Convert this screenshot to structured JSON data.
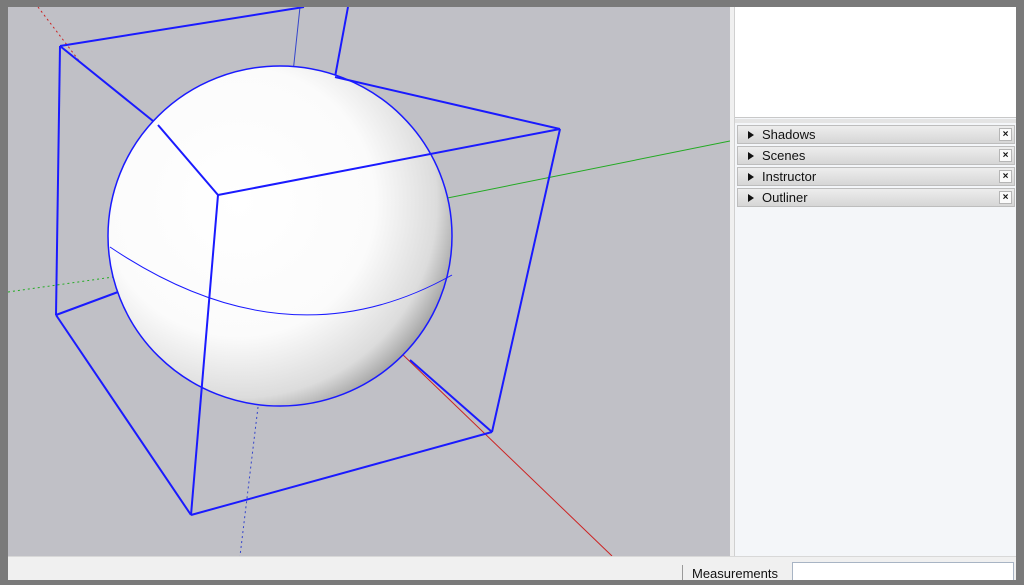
{
  "tray": {
    "panels": [
      {
        "label": "Shadows"
      },
      {
        "label": "Scenes"
      },
      {
        "label": "Instructor"
      },
      {
        "label": "Outliner"
      }
    ],
    "close_glyph": "×"
  },
  "statusbar": {
    "measurements_label": "Measurements",
    "measurements_value": ""
  },
  "colors": {
    "viewport_bg": "#c0c0c6",
    "edge_blue": "#1a1aff",
    "axis_red": "#cc2222",
    "axis_green": "#22aa22",
    "axis_blue": "#3344cc"
  }
}
